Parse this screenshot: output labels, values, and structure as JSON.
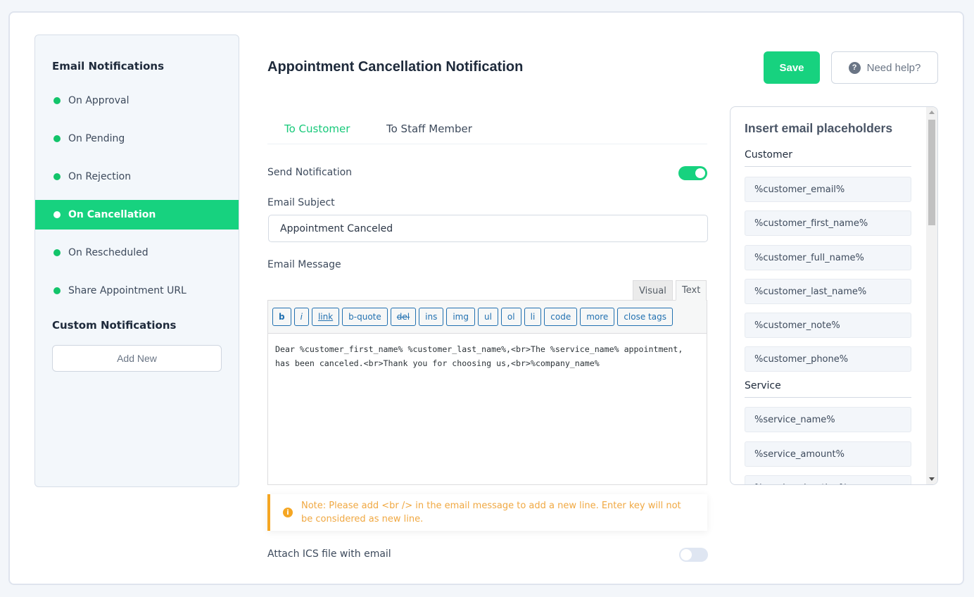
{
  "sidebar": {
    "heading": "Email Notifications",
    "items": [
      {
        "label": "On Approval"
      },
      {
        "label": "On Pending"
      },
      {
        "label": "On Rejection"
      },
      {
        "label": "On Cancellation",
        "active": true
      },
      {
        "label": "On Rescheduled"
      },
      {
        "label": "Share Appointment URL"
      }
    ],
    "custom_heading": "Custom Notifications",
    "add_new_label": "Add New"
  },
  "header": {
    "title": "Appointment Cancellation Notification",
    "save_label": "Save",
    "help_label": "Need help?",
    "help_icon": "?"
  },
  "tabs": [
    {
      "label": "To Customer",
      "active": true
    },
    {
      "label": "To Staff Member"
    }
  ],
  "form": {
    "send_notification_label": "Send Notification",
    "send_notification_on": true,
    "subject_label": "Email Subject",
    "subject_value": "Appointment Canceled",
    "message_label": "Email Message",
    "editor_tabs": {
      "visual": "Visual",
      "text": "Text"
    },
    "toolbar_buttons": [
      "b",
      "i",
      "link",
      "b-quote",
      "del",
      "ins",
      "img",
      "ul",
      "ol",
      "li",
      "code",
      "more",
      "close tags"
    ],
    "message_value": "Dear %customer_first_name% %customer_last_name%,<br>The %service_name% appointment, has been canceled.<br>Thank you for choosing us,<br>%company_name%",
    "note": "Note: Please add <br /> in the email message to add a new line. Enter key will not be considered as new line.",
    "note_icon": "i",
    "attach_ics_label": "Attach ICS file with email",
    "attach_ics_on": false
  },
  "placeholders": {
    "title": "Insert email placeholders",
    "groups": [
      {
        "name": "Customer",
        "items": [
          "%customer_email%",
          "%customer_first_name%",
          "%customer_full_name%",
          "%customer_last_name%",
          "%customer_note%",
          "%customer_phone%"
        ]
      },
      {
        "name": "Service",
        "items": [
          "%service_name%",
          "%service_amount%",
          "%service_duration%"
        ]
      }
    ]
  },
  "colors": {
    "accent": "#17d27f",
    "note": "#f5a623",
    "editor_link": "#2271b1"
  }
}
